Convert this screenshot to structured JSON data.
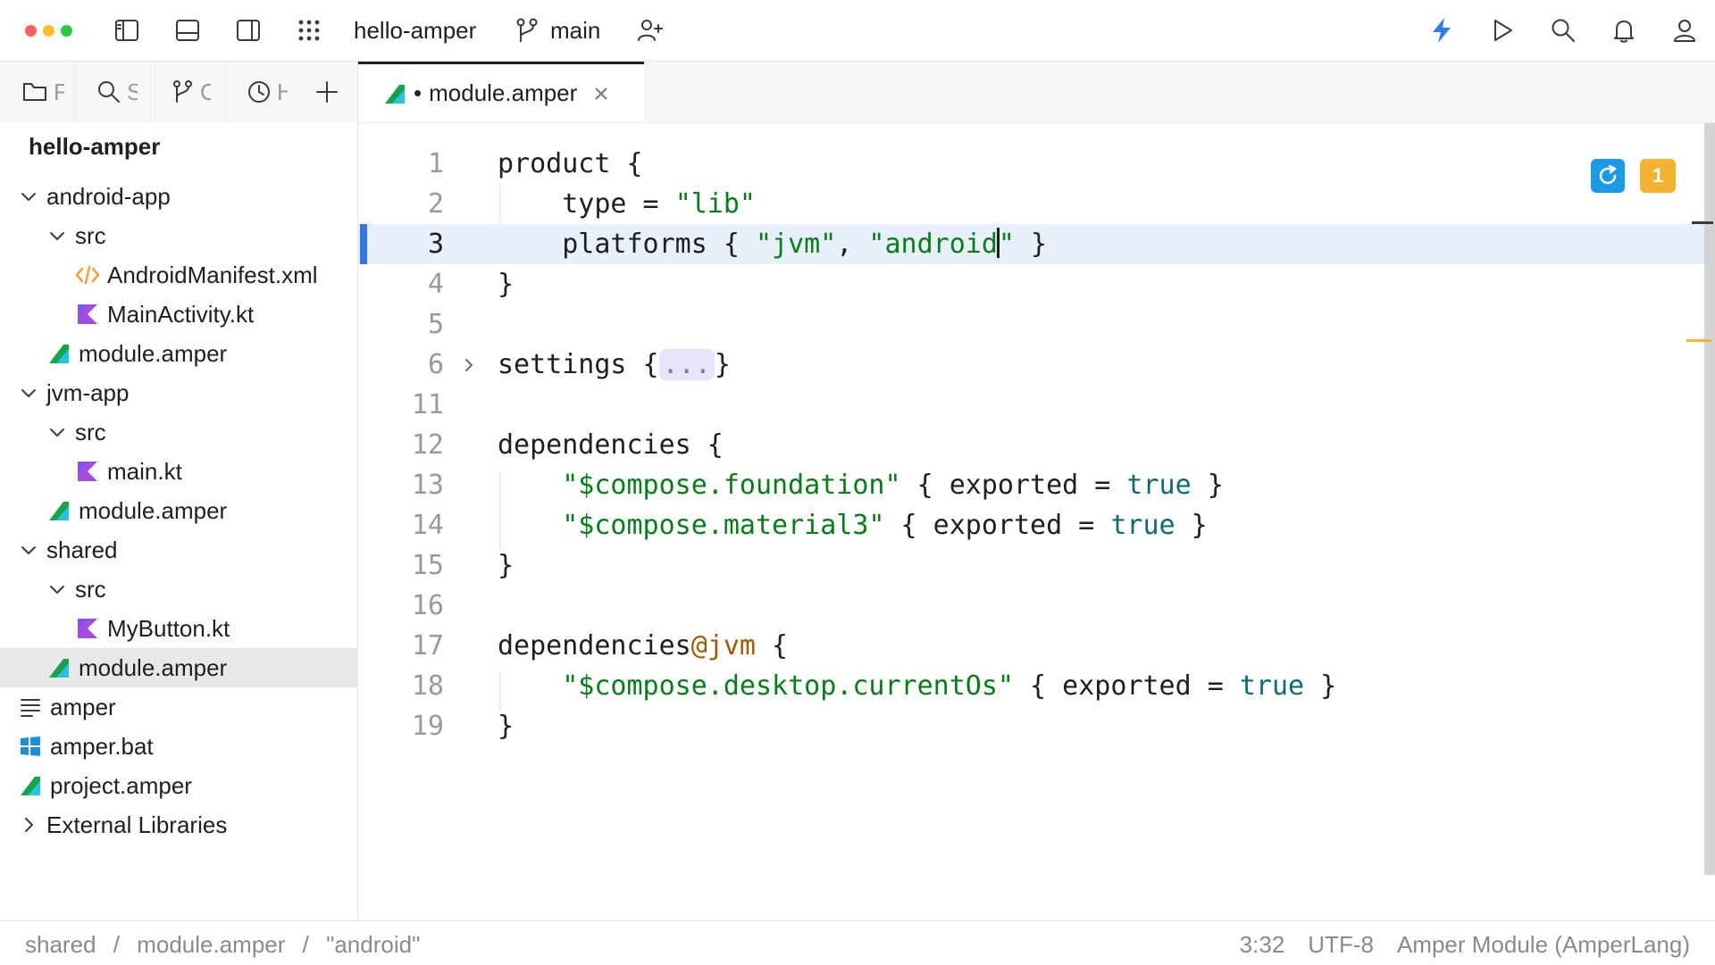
{
  "titlebar": {
    "project_name": "hello-amper",
    "branch": "main",
    "traffic_lights": [
      "#ff5f57",
      "#febc2e",
      "#28c840"
    ],
    "accent_color": "#2f7bf5"
  },
  "tool_tabs": [
    {
      "label": "F",
      "icon": "folder-icon"
    },
    {
      "label": "S",
      "icon": "search-icon"
    },
    {
      "label": "C",
      "icon": "git-branch-icon"
    },
    {
      "label": "H",
      "icon": "clock-icon"
    }
  ],
  "project": {
    "root": "hello-amper",
    "tree": [
      {
        "label": "android-app",
        "type": "folder",
        "expanded": true
      },
      {
        "label": "src",
        "type": "folder",
        "expanded": true
      },
      {
        "label": "AndroidManifest.xml",
        "type": "xml"
      },
      {
        "label": "MainActivity.kt",
        "type": "kotlin"
      },
      {
        "label": "module.amper",
        "type": "amper"
      },
      {
        "label": "jvm-app",
        "type": "folder",
        "expanded": true
      },
      {
        "label": "src",
        "type": "folder",
        "expanded": true
      },
      {
        "label": "main.kt",
        "type": "kotlin"
      },
      {
        "label": "module.amper",
        "type": "amper"
      },
      {
        "label": "shared",
        "type": "folder",
        "expanded": true
      },
      {
        "label": "src",
        "type": "folder",
        "expanded": true
      },
      {
        "label": "MyButton.kt",
        "type": "kotlin"
      },
      {
        "label": "module.amper",
        "type": "amper",
        "selected": true
      },
      {
        "label": "amper",
        "type": "text"
      },
      {
        "label": "amper.bat",
        "type": "windows"
      },
      {
        "label": "project.amper",
        "type": "amper"
      },
      {
        "label": "External Libraries",
        "type": "libraries",
        "expanded": false
      }
    ]
  },
  "editor": {
    "tab": {
      "name": "module.amper",
      "modified_marker": "•"
    },
    "warning_count": "1",
    "lines": [
      {
        "num": "1",
        "segs": [
          [
            "t",
            "product {"
          ]
        ]
      },
      {
        "num": "2",
        "segs": [
          [
            "t",
            "    type = "
          ],
          [
            "s",
            "\"lib\""
          ]
        ]
      },
      {
        "num": "3",
        "current": true,
        "segs": [
          [
            "t",
            "    platforms { "
          ],
          [
            "s",
            "\"jvm\""
          ],
          [
            "t",
            ", "
          ],
          [
            "s",
            "\"android"
          ],
          [
            "c",
            ""
          ],
          [
            "s",
            "\""
          ],
          [
            "t",
            " }"
          ]
        ]
      },
      {
        "num": "4",
        "segs": [
          [
            "t",
            "}"
          ]
        ]
      },
      {
        "num": "5",
        "segs": []
      },
      {
        "num": "6",
        "fold": true,
        "segs": [
          [
            "t",
            "settings {"
          ],
          [
            "f",
            "..."
          ],
          [
            "t",
            "}"
          ]
        ]
      },
      {
        "num": "11",
        "segs": []
      },
      {
        "num": "12",
        "segs": [
          [
            "t",
            "dependencies {"
          ]
        ]
      },
      {
        "num": "13",
        "segs": [
          [
            "t",
            "    "
          ],
          [
            "s",
            "\"$compose.foundation\""
          ],
          [
            "t",
            " { exported = "
          ],
          [
            "k",
            "true"
          ],
          [
            "t",
            " }"
          ]
        ]
      },
      {
        "num": "14",
        "segs": [
          [
            "t",
            "    "
          ],
          [
            "s",
            "\"$compose.material3\""
          ],
          [
            "t",
            " { exported = "
          ],
          [
            "k",
            "true"
          ],
          [
            "t",
            " }"
          ]
        ]
      },
      {
        "num": "15",
        "segs": [
          [
            "t",
            "}"
          ]
        ]
      },
      {
        "num": "16",
        "segs": []
      },
      {
        "num": "17",
        "segs": [
          [
            "t",
            "dependencies"
          ],
          [
            "a",
            "@jvm"
          ],
          [
            "t",
            " {"
          ]
        ]
      },
      {
        "num": "18",
        "segs": [
          [
            "t",
            "    "
          ],
          [
            "s",
            "\"$compose.desktop.currentOs\""
          ],
          [
            "t",
            " { exported = "
          ],
          [
            "k",
            "true"
          ],
          [
            "t",
            " }"
          ]
        ]
      },
      {
        "num": "19",
        "segs": [
          [
            "t",
            "}"
          ]
        ]
      }
    ]
  },
  "statusbar": {
    "breadcrumb": [
      "shared",
      "module.amper",
      "\"android\""
    ],
    "breadcrumb_sep": "/",
    "position": "3:32",
    "encoding": "UTF-8",
    "file_type": "Amper Module (AmperLang)"
  }
}
